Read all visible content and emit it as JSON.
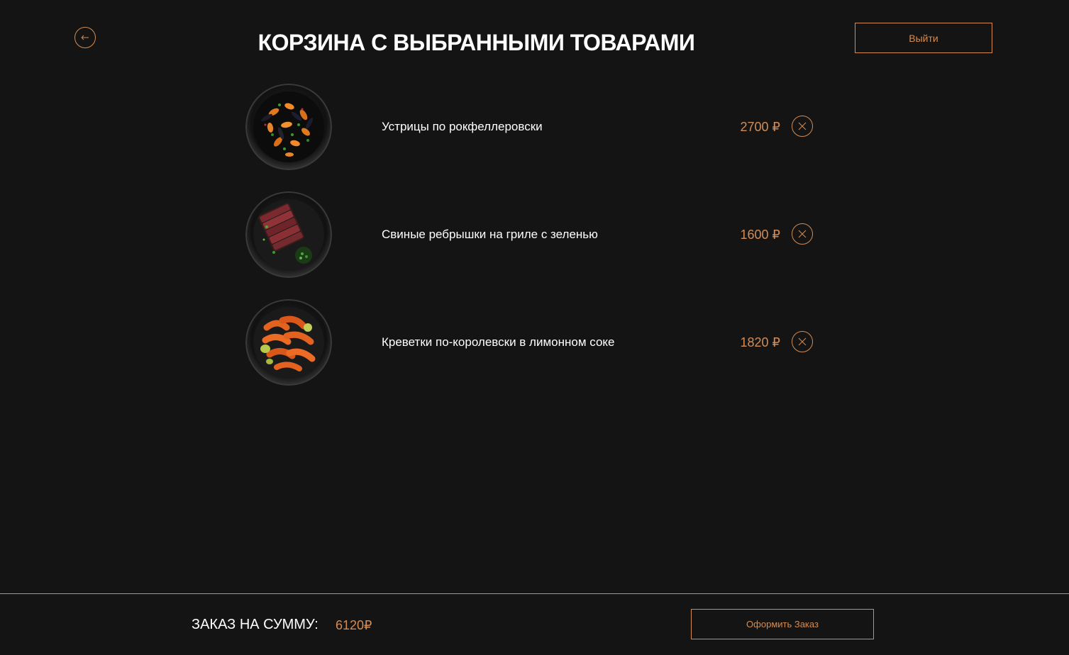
{
  "header": {
    "title": "КОРЗИНА С ВЫБРАННЫМИ ТОВАРАМИ",
    "back_icon": "arrow-left-icon",
    "logout_label": "Выйти"
  },
  "cart": {
    "items": [
      {
        "name": "Устрицы по рокфеллеровски",
        "price": "2700 ₽",
        "image": "mussels-dish",
        "remove_icon": "close-icon"
      },
      {
        "name": "Свиные ребрышки на гриле с зеленью",
        "price": "1600 ₽",
        "image": "grilled-ribs-dish",
        "remove_icon": "close-icon"
      },
      {
        "name": "Креветки по-королевски в лимонном соке",
        "price": "1820 ₽",
        "image": "shrimp-dish",
        "remove_icon": "close-icon"
      }
    ]
  },
  "footer": {
    "total_label": "ЗАКАЗ НА СУММУ:",
    "total_value": "6120₽",
    "checkout_label": "Оформить Заказ"
  },
  "colors": {
    "background": "#141414",
    "accent": "#d58c52",
    "text": "#ffffff"
  }
}
